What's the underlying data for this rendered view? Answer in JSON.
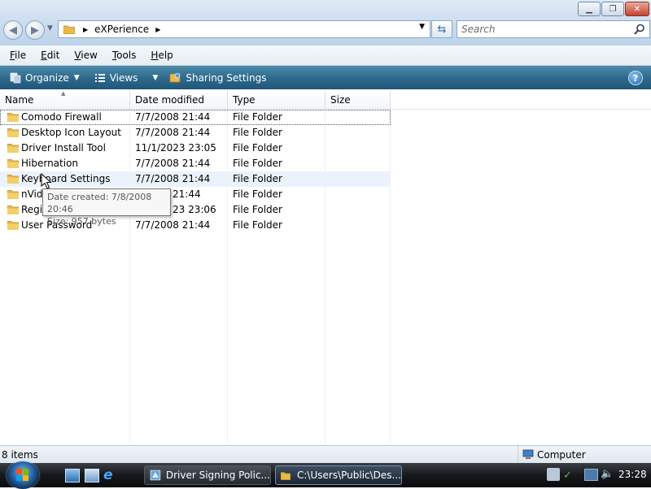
{
  "window": {
    "address": {
      "crumbs": [
        "eXPerience"
      ],
      "dropdown_icon": "chevron-down-icon"
    },
    "search": {
      "placeholder": "Search"
    }
  },
  "menu": [
    {
      "label": "File",
      "key": "F",
      "rest": "ile"
    },
    {
      "label": "Edit",
      "key": "E",
      "rest": "dit"
    },
    {
      "label": "View",
      "key": "V",
      "rest": "iew"
    },
    {
      "label": "Tools",
      "key": "T",
      "rest": "ools"
    },
    {
      "label": "Help",
      "key": "H",
      "rest": "elp"
    }
  ],
  "commandbar": {
    "organize": "Organize",
    "views": "Views",
    "sharing": "Sharing Settings"
  },
  "columns": {
    "name": "Name",
    "date_modified": "Date modified",
    "type": "Type",
    "size": "Size"
  },
  "files": [
    {
      "name": "Comodo Firewall",
      "date": "7/7/2008 21:44",
      "type": "File Folder"
    },
    {
      "name": "Desktop Icon Layout",
      "date": "7/7/2008 21:44",
      "type": "File Folder"
    },
    {
      "name": "Driver Install Tool",
      "date": "11/1/2023 23:05",
      "type": "File Folder"
    },
    {
      "name": "Hibernation",
      "date": "7/7/2008 21:44",
      "type": "File Folder"
    },
    {
      "name": "Keyboard Settings",
      "date": "7/7/2008 21:44",
      "type": "File Folder"
    },
    {
      "name": "nVid",
      "date": "21:44",
      "type": "File Folder"
    },
    {
      "name": "Regis",
      "date": "23 23:06",
      "type": "File Folder"
    },
    {
      "name": "User Password",
      "date": "7/7/2008 21:44",
      "type": "File Folder"
    }
  ],
  "tooltip": {
    "date_created": "Date created: 7/8/2008 20:46",
    "size": "Size: 957 bytes"
  },
  "status": {
    "items": "8 items",
    "zone": "Computer"
  },
  "taskbar": {
    "tasks": [
      "Driver Signing Polic...",
      "C:\\Users\\Public\\Des..."
    ],
    "clock": "23:28"
  },
  "colors": {
    "commandbar": "#2e6b8f",
    "folder": "#e8b94a",
    "taskbar": "#16181b"
  }
}
